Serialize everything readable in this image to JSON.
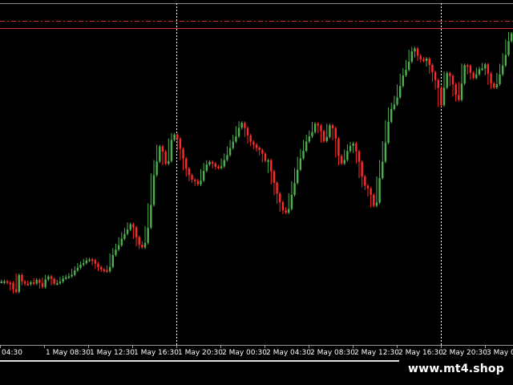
{
  "chart_data": {
    "type": "candlestick",
    "colors": {
      "background": "#000000",
      "bull": "#4caf50",
      "bear": "#ff2a2a",
      "grid": "#ffffff",
      "level": "#d03030"
    },
    "x_ticks": [
      "04:30",
      "1 May 08:30",
      "1 May 12:30",
      "1 May 16:30",
      "1 May 20:30",
      "2 May 00:30",
      "2 May 04:30",
      "2 May 08:30",
      "2 May 12:30",
      "2 May 16:30",
      "2 May 20:30",
      "3 May 00:30",
      "3"
    ],
    "series": [
      {
        "name": "",
        "values": [
          0.128,
          0.129,
          0.124,
          0.123,
          0.1,
          0.09,
          0.152,
          0.128,
          0.12,
          0.118,
          0.125,
          0.121,
          0.134,
          0.123,
          0.108,
          0.136,
          0.147,
          0.138,
          0.12,
          0.122,
          0.128,
          0.139,
          0.144,
          0.147,
          0.153,
          0.169,
          0.179,
          0.19,
          0.196,
          0.206,
          0.21,
          0.207,
          0.194,
          0.181,
          0.173,
          0.17,
          0.166,
          0.182,
          0.226,
          0.246,
          0.262,
          0.286,
          0.304,
          0.32,
          0.34,
          0.328,
          0.292,
          0.264,
          0.254,
          0.271,
          0.327,
          0.411,
          0.521,
          0.571,
          0.627,
          0.608,
          0.563,
          0.573,
          0.651,
          0.671,
          0.655,
          0.618,
          0.582,
          0.545,
          0.521,
          0.504,
          0.499,
          0.487,
          0.501,
          0.537,
          0.56,
          0.57,
          0.564,
          0.552,
          0.548,
          0.553,
          0.577,
          0.595,
          0.621,
          0.645,
          0.664,
          0.696,
          0.714,
          0.695,
          0.668,
          0.644,
          0.634,
          0.622,
          0.614,
          0.6,
          0.574,
          0.576,
          0.535,
          0.493,
          0.453,
          0.421,
          0.391,
          0.383,
          0.396,
          0.448,
          0.492,
          0.541,
          0.583,
          0.611,
          0.645,
          0.664,
          0.68,
          0.711,
          0.704,
          0.683,
          0.647,
          0.662,
          0.705,
          0.694,
          0.656,
          0.592,
          0.564,
          0.577,
          0.61,
          0.629,
          0.638,
          0.609,
          0.57,
          0.516,
          0.482,
          0.472,
          0.448,
          0.408,
          0.42,
          0.51,
          0.571,
          0.641,
          0.718,
          0.765,
          0.782,
          0.808,
          0.85,
          0.889,
          0.91,
          0.94,
          0.978,
          0.989,
          0.962,
          0.949,
          0.943,
          0.951,
          0.928,
          0.901,
          0.872,
          0.843,
          0.779,
          0.844,
          0.898,
          0.887,
          0.856,
          0.817,
          0.799,
          0.859,
          0.927,
          0.925,
          0.899,
          0.88,
          0.893,
          0.912,
          0.915,
          0.93,
          0.896,
          0.86,
          0.845,
          0.857,
          0.893,
          0.926,
          0.965,
          1.016,
          1.044
        ]
      }
    ],
    "ylim": [
      -0.1,
      1.15
    ],
    "levels": [
      1.09,
      1.065
    ],
    "vertical_markers": [
      "1 May 20:30",
      "2 May 20:30"
    ]
  },
  "watermark": "www.mt4.shop"
}
